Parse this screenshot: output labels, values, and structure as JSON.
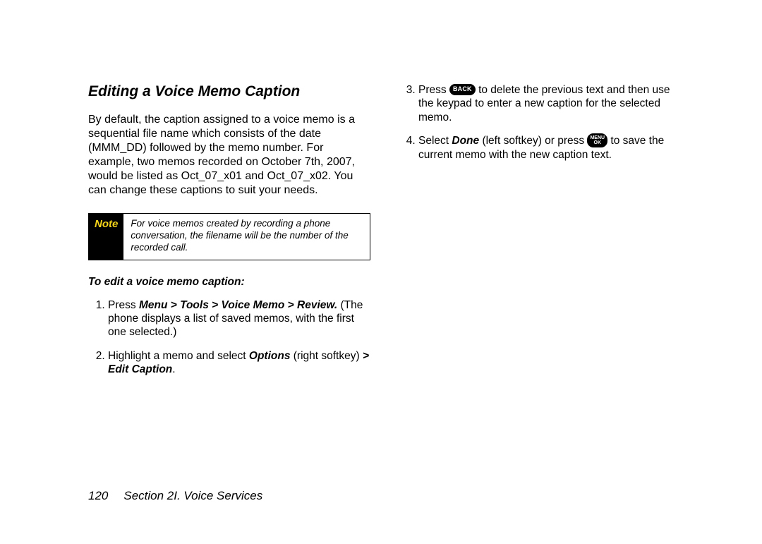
{
  "heading": "Editing a Voice Memo Caption",
  "intro": "By default, the caption assigned to a voice memo is a sequential file name which consists of the date (MMM_DD) followed by the memo number. For example, two memos recorded on October 7th, 2007, would be listed as Oct_07_x01 and Oct_07_x02. You can change these captions to suit your needs.",
  "note": {
    "label": "Note",
    "text": "For voice memos created by recording a phone conversation, the filename will be the number of the recorded call."
  },
  "sub_heading": "To edit a voice memo caption:",
  "steps": {
    "s1_a": "Press ",
    "s1_path": "Menu > Tools > Voice Memo > Review.",
    "s1_b": " (The phone displays a list of saved memos, with the first one selected.)",
    "s2_a": "Highlight a memo and select ",
    "s2_opt": "Options",
    "s2_b": " (right softkey) ",
    "s2_edit": "> Edit Caption",
    "s2_c": ".",
    "s3_a": "Press ",
    "s3_b": " to delete the previous text and then use the keypad to enter a new caption for the selected memo.",
    "s4_a": "Select ",
    "s4_done": "Done",
    "s4_b": " (left softkey) or press ",
    "s4_c": " to save the current memo with the new caption text."
  },
  "keys": {
    "back": "BACK",
    "menu": "MENU",
    "ok": "OK"
  },
  "footer": {
    "page_number": "120",
    "section": "Section 2I. Voice Services"
  }
}
